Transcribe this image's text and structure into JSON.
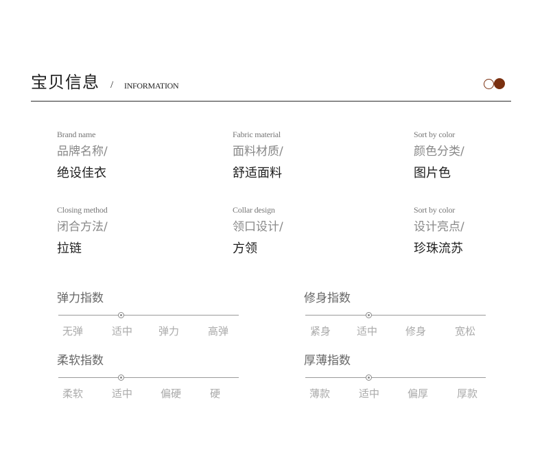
{
  "header": {
    "title_cn": "宝贝信息",
    "slash": "/",
    "title_en": "INFORMATION",
    "accent_color": "#7a3010"
  },
  "info_rows": [
    [
      {
        "en": "Brand name",
        "label": "品牌名称/",
        "value": "绝设佳衣"
      },
      {
        "en": "Fabric material",
        "label": "面料材质/",
        "value": "舒适面料"
      },
      {
        "en": "Sort by color",
        "label": "颜色分类/",
        "value": "图片色"
      }
    ],
    [
      {
        "en": "Closing method",
        "label": "闭合方法/",
        "value": "拉链"
      },
      {
        "en": "Collar design",
        "label": "领口设计/",
        "value": "方领"
      },
      {
        "en": "Sort by color",
        "label": "设计亮点/",
        "value": "珍珠流苏"
      }
    ]
  ],
  "scales": [
    {
      "title": "弹力指数",
      "options": [
        "无弹",
        "适中",
        "弹力",
        "高弹"
      ],
      "selected": "适中",
      "selected_index": 1
    },
    {
      "title": "修身指数",
      "options": [
        "紧身",
        "适中",
        "修身",
        "宽松"
      ],
      "selected": "适中",
      "selected_index": 1
    },
    {
      "title": "柔软指数",
      "options": [
        "柔软",
        "适中",
        "偏硬",
        "硬"
      ],
      "selected": "适中",
      "selected_index": 1
    },
    {
      "title": "厚薄指数",
      "options": [
        "薄款",
        "适中",
        "偏厚",
        "厚款"
      ],
      "selected": "适中",
      "selected_index": 1
    }
  ]
}
